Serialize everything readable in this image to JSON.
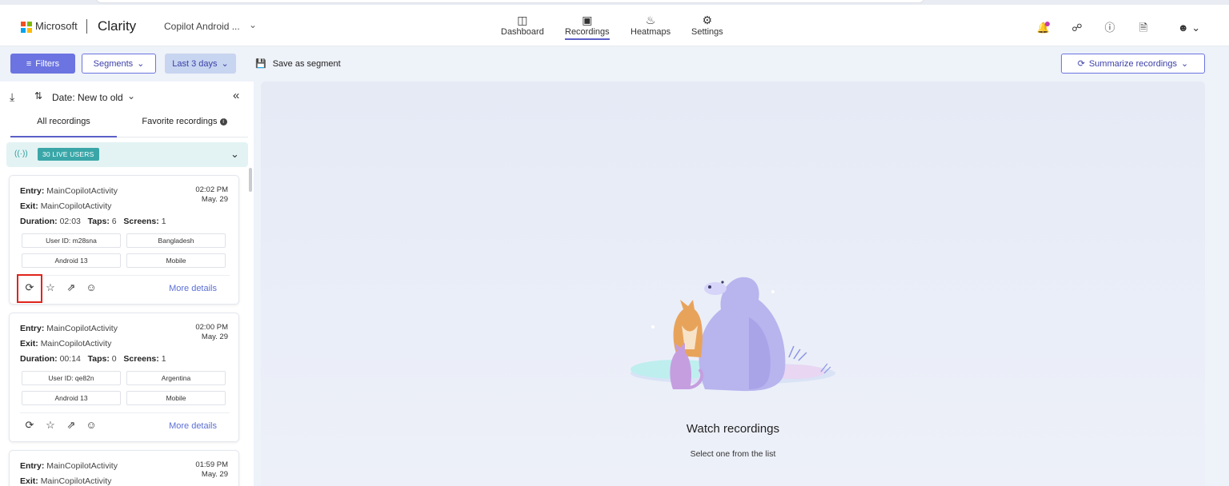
{
  "header": {
    "brand": "Microsoft",
    "product": "Clarity",
    "project": "Copilot Android ...",
    "nav": [
      {
        "label": "Dashboard",
        "icon": "dashboard-icon"
      },
      {
        "label": "Recordings",
        "icon": "video-icon",
        "active": true
      },
      {
        "label": "Heatmaps",
        "icon": "flame-icon"
      },
      {
        "label": "Settings",
        "icon": "gear-icon"
      }
    ]
  },
  "toolbar": {
    "filters_label": "Filters",
    "segments_label": "Segments",
    "days_label": "Last 3 days",
    "save_segment_label": "Save as segment",
    "summarize_label": "Summarize recordings"
  },
  "sidebar": {
    "sort_label": "Date: New to old",
    "tabs": [
      {
        "label": "All recordings",
        "active": true
      },
      {
        "label": "Favorite recordings"
      }
    ],
    "live_users_label": "30 LIVE USERS",
    "recordings": [
      {
        "entry_label": "Entry:",
        "entry": "MainCopilotActivity",
        "exit_label": "Exit:",
        "exit": "MainCopilotActivity",
        "duration_label": "Duration:",
        "duration": "02:03",
        "taps_label": "Taps:",
        "taps": "6",
        "screens_label": "Screens:",
        "screens": "1",
        "time": "02:02 PM",
        "date": "May. 29",
        "user_id": "User ID: m28sna",
        "country": "Bangladesh",
        "os": "Android 13",
        "device": "Mobile",
        "more": "More details"
      },
      {
        "entry_label": "Entry:",
        "entry": "MainCopilotActivity",
        "exit_label": "Exit:",
        "exit": "MainCopilotActivity",
        "duration_label": "Duration:",
        "duration": "00:14",
        "taps_label": "Taps:",
        "taps": "0",
        "screens_label": "Screens:",
        "screens": "1",
        "time": "02:00 PM",
        "date": "May. 29",
        "user_id": "User ID: qe82n",
        "country": "Argentina",
        "os": "Android 13",
        "device": "Mobile",
        "more": "More details"
      },
      {
        "entry_label": "Entry:",
        "entry": "MainCopilotActivity",
        "exit_label": "Exit:",
        "exit": "MainCopilotActivity",
        "time": "01:59 PM",
        "date": "May. 29"
      }
    ]
  },
  "main": {
    "empty_title": "Watch recordings",
    "empty_subtitle": "Select one from the list"
  },
  "colors": {
    "accent": "#5b5fc7",
    "filters_bg": "#6b74e0",
    "live_badge": "#3aa6a8",
    "highlight_box": "#e0241b"
  }
}
